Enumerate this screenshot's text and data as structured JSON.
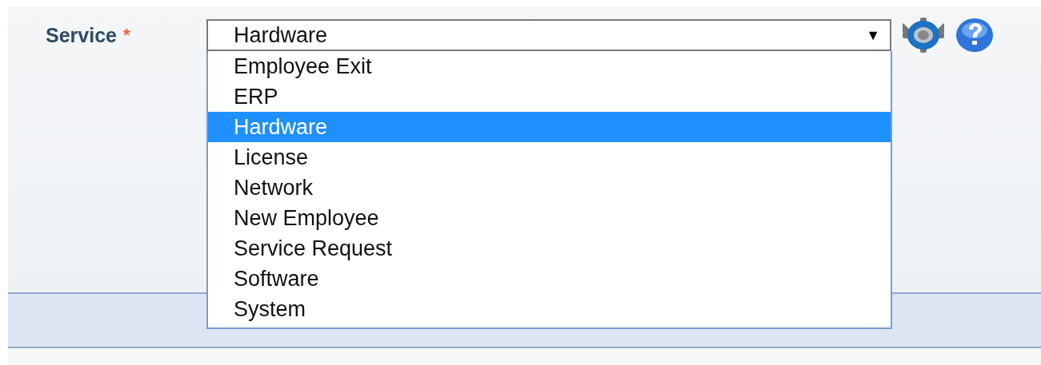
{
  "field": {
    "label": "Service",
    "required_mark": "*",
    "value": "Hardware",
    "arrow": "▼",
    "expanded": true
  },
  "options": [
    {
      "label": "Employee Exit",
      "selected": false
    },
    {
      "label": "ERP",
      "selected": false
    },
    {
      "label": "Hardware",
      "selected": true
    },
    {
      "label": "License",
      "selected": false
    },
    {
      "label": "Network",
      "selected": false
    },
    {
      "label": "New Employee",
      "selected": false
    },
    {
      "label": "Service Request",
      "selected": false
    },
    {
      "label": "Software",
      "selected": false
    },
    {
      "label": "System",
      "selected": false
    }
  ]
}
